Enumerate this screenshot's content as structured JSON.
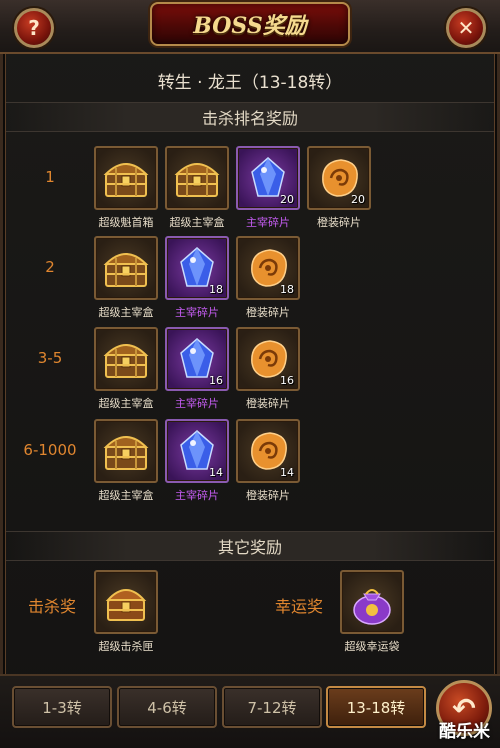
{
  "header": {
    "title": "BOSS奖励",
    "help_icon": "?",
    "close_icon": "✕"
  },
  "boss_name": "转生 · 龙王（13-18转）",
  "sections": {
    "ranking_title": "击杀排名奖励",
    "other_title": "其它奖励"
  },
  "ranks": [
    {
      "label": "1",
      "items": [
        {
          "name": "超级魁首箱",
          "icon": "gold-chest-icon",
          "style": "brown",
          "qty": ""
        },
        {
          "name": "超级主宰盒",
          "icon": "gold-chest-icon",
          "style": "brown",
          "qty": ""
        },
        {
          "name": "主宰碎片",
          "icon": "blue-crystal-icon",
          "style": "purple",
          "qty": "20"
        },
        {
          "name": "橙装碎片",
          "icon": "orange-shard-icon",
          "style": "brown",
          "qty": "20"
        }
      ]
    },
    {
      "label": "2",
      "items": [
        {
          "name": "超级主宰盒",
          "icon": "gold-chest-icon",
          "style": "brown",
          "qty": ""
        },
        {
          "name": "主宰碎片",
          "icon": "blue-crystal-icon",
          "style": "purple",
          "qty": "18"
        },
        {
          "name": "橙装碎片",
          "icon": "orange-shard-icon",
          "style": "brown",
          "qty": "18"
        }
      ]
    },
    {
      "label": "3-5",
      "items": [
        {
          "name": "超级主宰盒",
          "icon": "gold-chest-icon",
          "style": "brown",
          "qty": ""
        },
        {
          "name": "主宰碎片",
          "icon": "blue-crystal-icon",
          "style": "purple",
          "qty": "16"
        },
        {
          "name": "橙装碎片",
          "icon": "orange-shard-icon",
          "style": "brown",
          "qty": "16"
        }
      ]
    },
    {
      "label": "6-1000",
      "items": [
        {
          "name": "超级主宰盒",
          "icon": "gold-chest-icon",
          "style": "brown",
          "qty": ""
        },
        {
          "name": "主宰碎片",
          "icon": "blue-crystal-icon",
          "style": "purple",
          "qty": "14"
        },
        {
          "name": "橙装碎片",
          "icon": "orange-shard-icon",
          "style": "brown",
          "qty": "14"
        }
      ]
    }
  ],
  "other": {
    "kill_label": "击杀奖",
    "kill_item": {
      "name": "超级击杀匣",
      "icon": "treasure-chest-icon"
    },
    "lucky_label": "幸运奖",
    "lucky_item": {
      "name": "超级幸运袋",
      "icon": "lucky-bag-icon"
    }
  },
  "tabs": [
    {
      "label": "1-3转",
      "active": false
    },
    {
      "label": "4-6转",
      "active": false
    },
    {
      "label": "7-12转",
      "active": false
    },
    {
      "label": "13-18转",
      "active": true
    }
  ],
  "back_icon": "↶",
  "watermark": "酷乐米",
  "colors": {
    "accent_orange": "#e0862f",
    "purple_text": "#c35cf0",
    "title_gold": "#f5d98e"
  }
}
